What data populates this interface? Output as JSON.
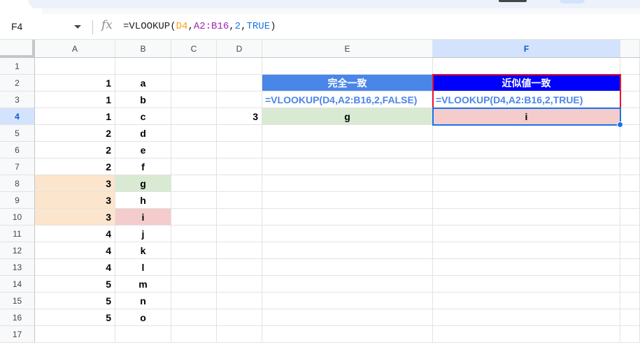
{
  "formula_bar": {
    "cell_ref": "F4",
    "fx_label": "fx",
    "formula_parts": [
      {
        "text": "=VLOOKUP(",
        "color": "#1f1f1f"
      },
      {
        "text": "D4",
        "color": "#f4a20b"
      },
      {
        "text": ",",
        "color": "#1f1f1f"
      },
      {
        "text": "A2:B16",
        "color": "#9c27b0"
      },
      {
        "text": ",",
        "color": "#1f1f1f"
      },
      {
        "text": "2",
        "color": "#1a73e8"
      },
      {
        "text": ",",
        "color": "#1f1f1f"
      },
      {
        "text": "TRUE",
        "color": "#1a73e8"
      },
      {
        "text": ")",
        "color": "#1f1f1f"
      }
    ]
  },
  "columns": [
    "A",
    "B",
    "C",
    "D",
    "E",
    "F"
  ],
  "rows": [
    "1",
    "2",
    "3",
    "4",
    "5",
    "6",
    "7",
    "8",
    "9",
    "10",
    "11",
    "12",
    "13",
    "14",
    "15",
    "16",
    "17"
  ],
  "selected_cell": {
    "column": "F",
    "row": "4"
  },
  "cells": {
    "A2": "1",
    "B2": "a",
    "A3": "1",
    "B3": "b",
    "A4": "1",
    "B4": "c",
    "A5": "2",
    "B5": "d",
    "A6": "2",
    "B6": "e",
    "A7": "2",
    "B7": "f",
    "A8": "3",
    "B8": "g",
    "A9": "3",
    "B9": "h",
    "A10": "3",
    "B10": "i",
    "A11": "4",
    "B11": "j",
    "A12": "4",
    "B12": "k",
    "A13": "4",
    "B13": "l",
    "A14": "5",
    "B14": "m",
    "A15": "5",
    "B15": "n",
    "A16": "5",
    "B16": "o",
    "D4": "3",
    "E2": "完全一致",
    "F2": "近似値一致",
    "E3": "=VLOOKUP(D4,A2:B16,2,FALSE)",
    "F3": "=VLOOKUP(D4,A2:B16,2,TRUE)",
    "E4": "g",
    "F4": "i"
  },
  "colors": {
    "orange_fill": "#fce5cd",
    "green_fill": "#d9ead3",
    "red_fill": "#f4cccc",
    "exact_header_fill": "#4a86e8",
    "approx_header_fill": "#0000ff",
    "highlight_border": "#e8112d",
    "selection": "#1a73e8"
  }
}
